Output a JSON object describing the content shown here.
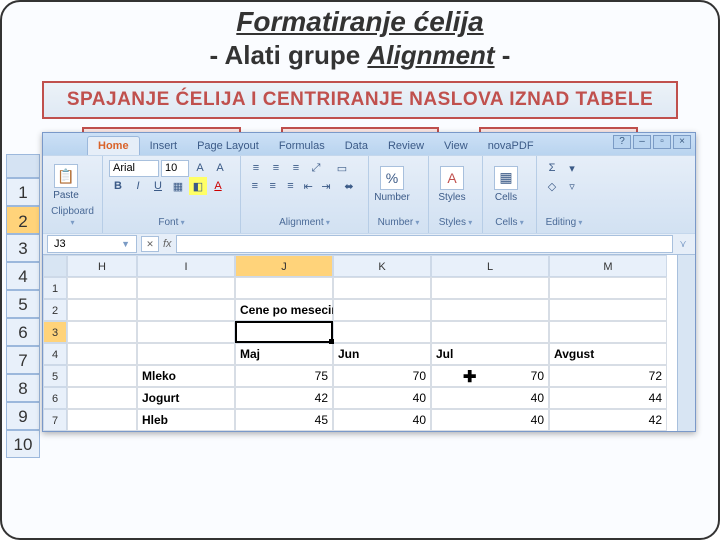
{
  "title": "Formatiranje ćelija",
  "subtitle_pre": "- Alati grupe ",
  "subtitle_em": "Alignment",
  "subtitle_post": " -",
  "banner": "SPAJANJE ĆELIJA I CENTRIRANJE NASLOVA IZNAD TABELE",
  "ribbon": {
    "tabs": [
      "Home",
      "Insert",
      "Page Layout",
      "Formulas",
      "Data",
      "Review",
      "View",
      "novaPDF"
    ],
    "active": 0,
    "clipboard": {
      "label": "Clipboard",
      "paste": "Paste"
    },
    "font": {
      "label": "Font",
      "name": "Arial",
      "size": "10"
    },
    "alignment": {
      "label": "Alignment"
    },
    "number": {
      "label": "Number",
      "btn": "Number",
      "percent": "%"
    },
    "styles": {
      "label": "Styles",
      "btn": "Styles"
    },
    "cells": {
      "label": "Cells",
      "btn": "Cells"
    },
    "editing": {
      "label": "Editing",
      "sigma": "Σ"
    }
  },
  "namebox": "J3",
  "bigrows": [
    "1",
    "2",
    "3",
    "4",
    "5",
    "6",
    "7",
    "8",
    "9",
    "10"
  ],
  "bigrows_sel": 1,
  "sheet": {
    "cols": [
      "H",
      "I",
      "J",
      "K",
      "L",
      "M"
    ],
    "colsel": 2,
    "rows": [
      "1",
      "2",
      "3",
      "4",
      "5",
      "6",
      "7"
    ],
    "rowsel": 2,
    "merged_title": "Cene po mesecima",
    "data": {
      "4": {
        "J": "Maj",
        "K": "Jun",
        "L": "Jul",
        "M": "Avgust"
      },
      "5": {
        "I": "Mleko",
        "J": "75",
        "K": "70",
        "L": "70",
        "M": "72"
      },
      "6": {
        "I": "Jogurt",
        "J": "42",
        "K": "40",
        "L": "40",
        "M": "44"
      },
      "7": {
        "I": "Hleb",
        "J": "45",
        "K": "40",
        "L": "40",
        "M": "42"
      }
    }
  },
  "chart_data": {
    "type": "table",
    "title": "Cene po mesecima",
    "columns": [
      "Maj",
      "Jun",
      "Jul",
      "Avgust"
    ],
    "rows": [
      "Mleko",
      "Jogurt",
      "Hleb"
    ],
    "values": [
      [
        75,
        70,
        70,
        72
      ],
      [
        42,
        40,
        40,
        44
      ],
      [
        45,
        40,
        40,
        42
      ]
    ]
  }
}
